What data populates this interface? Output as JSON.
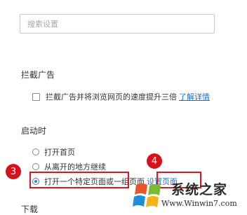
{
  "search": {
    "placeholder": "搜索设置"
  },
  "ad_block": {
    "title": "拦截广告",
    "checkbox_label": "拦截广告并将浏览网页的速度提升三倍",
    "checked": false,
    "learn_more_link": "了解详情"
  },
  "startup": {
    "title": "启动时",
    "options": [
      {
        "label": "打开首页",
        "selected": false
      },
      {
        "label": "从离开的地方继续",
        "selected": false
      },
      {
        "label": "打开一个特定页面或一组页面",
        "selected": true
      }
    ],
    "set_pages_link": "设置页面"
  },
  "download": {
    "title": "下载"
  },
  "annotations": {
    "marker_3": "3",
    "marker_4": "4",
    "color": "#e5141c"
  },
  "watermark": {
    "brand": "系统之家",
    "url": "Www.Winwin7.com"
  }
}
